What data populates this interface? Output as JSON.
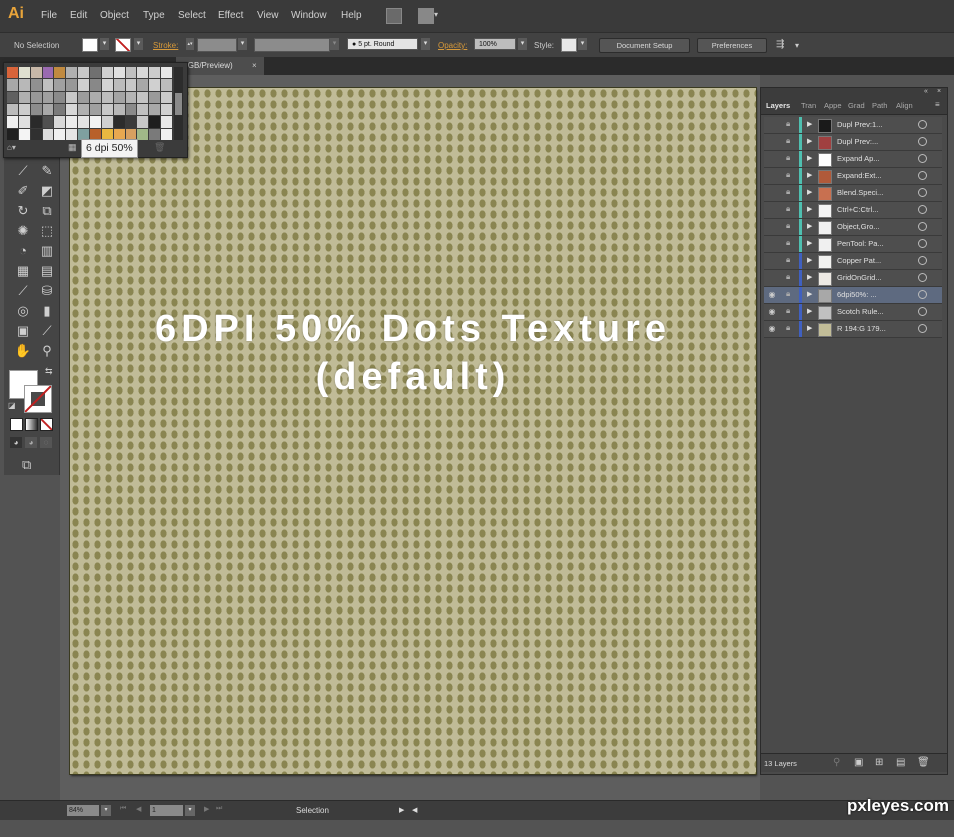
{
  "app": {
    "logo": "Ai"
  },
  "menubar": {
    "items": [
      "File",
      "Edit",
      "Object",
      "Type",
      "Select",
      "Effect",
      "View",
      "Window",
      "Help"
    ],
    "bridge_icon": "bridge-icon",
    "arrange_icon": "arrange-documents-icon"
  },
  "control_bar": {
    "selection_label": "No Selection",
    "stroke_label": "Stroke:",
    "brush_value": "5 pt. Round",
    "opacity_label": "Opacity:",
    "opacity_value": "100%",
    "style_label": "Style:",
    "document_setup_label": "Document Setup",
    "preferences_label": "Preferences",
    "dropdown_glyph": "▾"
  },
  "document_tab": {
    "title": "RGB/Preview)",
    "close_glyph": "×"
  },
  "swatch_panel": {
    "tooltip": "6 dpi 50%",
    "colors": [
      "#d9643a",
      "#e0e0d0",
      "#c8b8a8",
      "#9a6ab0",
      "#c08a40",
      "#b0b0b0",
      "#c8c8c8",
      "#707070",
      "#d0d0d0",
      "#e0e0e0",
      "#c0c0c0",
      "#d8d8d8",
      "#cccccc",
      "#e8e8e8",
      "#a8a8a8",
      "#b8b8b8",
      "#909090",
      "#c0c0c0",
      "#a0a0a0",
      "#989898",
      "#d0d0d0",
      "#888888",
      "#d4d4d4",
      "#bcbcbc",
      "#c8c8c8",
      "#a8a8a8",
      "#d0d0d0",
      "#bcbcbc",
      "#606060",
      "#b0b0b0",
      "#989898",
      "#a0a0a0",
      "#8a8a8a",
      "#c8c8c8",
      "#9c9c9c",
      "#acacac",
      "#bdbdbd",
      "#a4a4a4",
      "#b4b4b4",
      "#c4c4c4",
      "#9a9a9a",
      "#cacaca",
      "#bcbcbc",
      "#cccccc",
      "#8c8c8c",
      "#a8a8a8",
      "#7a7a7a",
      "#d8d8d8",
      "#b0b0b0",
      "#a0a0a0",
      "#c8c8c8",
      "#b8b8b8",
      "#8a8a8a",
      "#c0c0c0",
      "#a8a8a8",
      "#d0d0d0",
      "#f0f0f0",
      "#e0e0e0",
      "#2a2a2a",
      "#505050",
      "#d8d8d8",
      "#ececec",
      "#e4e4e4",
      "#f2f2f2",
      "#d0d0d0",
      "#2c2c2c",
      "#3a3a3a",
      "#c8c8c8",
      "#1e1e1e",
      "#e8e8e8",
      "#202020",
      "#f4f4f4",
      "#303030",
      "#dcdcdc",
      "#f0f0f0",
      "#e6e6e6",
      "#7fa0a0",
      "#b8602a",
      "#e8b840",
      "#e8a850",
      "#d8a060",
      "#a0b888",
      "#7a7a7a",
      "#f0f0f0"
    ]
  },
  "tools": {
    "rows": [
      [
        "paintbrush-tool",
        "pencil-tool"
      ],
      [
        "blob-brush-tool",
        "eraser-tool"
      ],
      [
        "rotate-tool",
        "scale-tool"
      ],
      [
        "warp-tool",
        "free-transform-tool"
      ],
      [
        "shape-builder-tool",
        "perspective-grid-tool"
      ],
      [
        "mesh-tool",
        "gradient-tool"
      ],
      [
        "eyedropper-tool",
        "blend-tool"
      ],
      [
        "symbol-sprayer-tool",
        "column-graph-tool"
      ],
      [
        "artboard-tool",
        "slice-tool"
      ],
      [
        "hand-tool",
        "zoom-tool"
      ]
    ],
    "glyphs": [
      [
        "⟋",
        "✎"
      ],
      [
        "✐",
        "◩"
      ],
      [
        "↻",
        "⧉"
      ],
      [
        "✺",
        "⬚"
      ],
      [
        "◔",
        "▥"
      ],
      [
        "▦",
        "▤"
      ],
      [
        "⟋",
        "⛁"
      ],
      [
        "◎",
        "▮"
      ],
      [
        "▣",
        "⟋"
      ],
      [
        "✋",
        "⚲"
      ]
    ],
    "fill_color": "#ffffff",
    "stroke_color": "none"
  },
  "canvas": {
    "headline_line1": "6DPI 50% Dots Texture",
    "headline_line2": "(default)",
    "background_color": "#c0bb97",
    "dot_color": "#8a8551"
  },
  "layers_panel": {
    "tabs": [
      "Layers",
      "Tran",
      "Appe",
      "Grad",
      "Path",
      "Align"
    ],
    "active_tab": "Layers",
    "layers": [
      {
        "name": "Dupl Prev:1...",
        "visible": false,
        "color": "#4fbfb0",
        "thumb": "#1a1a1a",
        "selected": false
      },
      {
        "name": "Dupl Prev:...",
        "visible": false,
        "color": "#4fbfb0",
        "thumb": "#a04040",
        "selected": false
      },
      {
        "name": "Expand Ap...",
        "visible": false,
        "color": "#4fbfb0",
        "thumb": "#ffffff",
        "selected": false
      },
      {
        "name": "Expand:Ext...",
        "visible": false,
        "color": "#4fbfb0",
        "thumb": "#b05a3a",
        "selected": false
      },
      {
        "name": "Blend.Speci...",
        "visible": false,
        "color": "#4fbfb0",
        "thumb": "#c87050",
        "selected": false
      },
      {
        "name": "Ctrl+C:Ctrl...",
        "visible": false,
        "color": "#4fbfb0",
        "thumb": "#f4f4f4",
        "selected": false
      },
      {
        "name": "Object,Gro...",
        "visible": false,
        "color": "#4fbfb0",
        "thumb": "#f0f0f0",
        "selected": false
      },
      {
        "name": "PenTool: Pa...",
        "visible": false,
        "color": "#4fbfb0",
        "thumb": "#f0f0f0",
        "selected": false
      },
      {
        "name": "Copper Pat...",
        "visible": false,
        "color": "#4060c0",
        "thumb": "#f2f2f0",
        "selected": false
      },
      {
        "name": "GridOnGrid...",
        "visible": false,
        "color": "#4060c0",
        "thumb": "#eeeae4",
        "selected": false
      },
      {
        "name": "6dpi50%: ...",
        "visible": true,
        "color": "#4060c0",
        "thumb": "#a8a8a8",
        "selected": true
      },
      {
        "name": "Scotch Rule...",
        "visible": true,
        "color": "#4060c0",
        "thumb": "#c0c0c0",
        "selected": false
      },
      {
        "name": "R 194:G 179...",
        "visible": true,
        "color": "#4060c0",
        "thumb": "#c2bd98",
        "selected": false
      }
    ],
    "count_label": "13 Layers"
  },
  "status_bar": {
    "zoom": "84%",
    "page": "1",
    "status_text": "Selection"
  },
  "watermark": "pxleyes.com"
}
